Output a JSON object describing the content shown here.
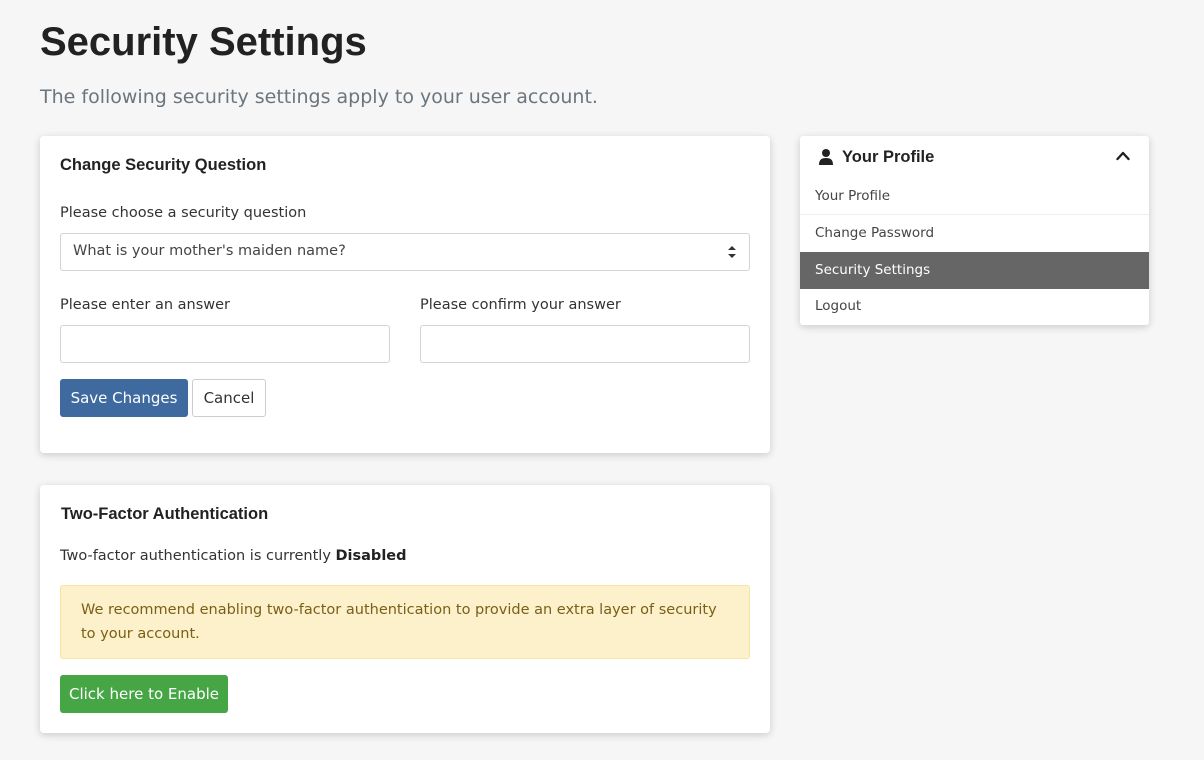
{
  "page": {
    "title": "Security Settings",
    "subtitle": "The following security settings apply to your user account."
  },
  "security_question": {
    "heading": "Change Security Question",
    "choose_label": "Please choose a security question",
    "selected_question": "What is your mother's maiden name?",
    "answer_label": "Please enter an answer",
    "answer_value": "",
    "confirm_label": "Please confirm your answer",
    "confirm_value": "",
    "save_label": "Save Changes",
    "cancel_label": "Cancel",
    "save_color": "#3f6a9f"
  },
  "two_factor": {
    "heading": "Two-Factor Authentication",
    "status_prefix": "Two-factor authentication is currently",
    "status_value": "Disabled",
    "recommendation": "We recommend enabling two-factor authentication to provide an extra layer of security to your account.",
    "enable_label": "Click here to Enable",
    "enable_color": "#46a645",
    "alert_bg": "#fcf1cb"
  },
  "sidebar": {
    "title": "Your Profile",
    "icon": "user-icon",
    "toggle_icon": "chevron-up-icon",
    "active_color": "#666666",
    "items": [
      {
        "label": "Your Profile"
      },
      {
        "label": "Change Password"
      },
      {
        "label": "Security Settings",
        "active": true
      },
      {
        "label": "Logout"
      }
    ]
  }
}
